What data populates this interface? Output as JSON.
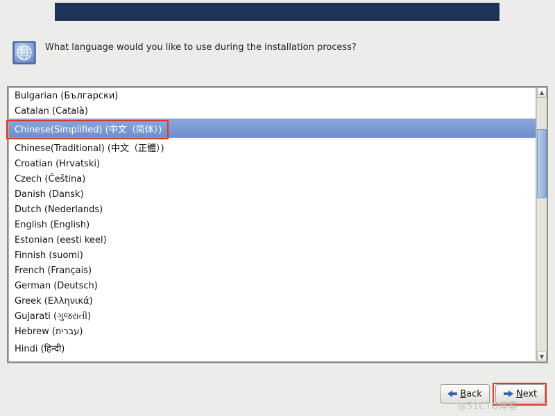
{
  "prompt": "What language would you like to use during the installation process?",
  "languages": [
    {
      "label": "Bulgarian (Български)",
      "selected": false
    },
    {
      "label": "Catalan (Català)",
      "selected": false
    },
    {
      "label": "Chinese(Simplified) (中文（简体）)",
      "selected": true
    },
    {
      "label": "Chinese(Traditional) (中文（正體）)",
      "selected": false
    },
    {
      "label": "Croatian (Hrvatski)",
      "selected": false
    },
    {
      "label": "Czech (Čeština)",
      "selected": false
    },
    {
      "label": "Danish (Dansk)",
      "selected": false
    },
    {
      "label": "Dutch (Nederlands)",
      "selected": false
    },
    {
      "label": "English (English)",
      "selected": false
    },
    {
      "label": "Estonian (eesti keel)",
      "selected": false
    },
    {
      "label": "Finnish (suomi)",
      "selected": false
    },
    {
      "label": "French (Français)",
      "selected": false
    },
    {
      "label": "German (Deutsch)",
      "selected": false
    },
    {
      "label": "Greek (Ελληνικά)",
      "selected": false
    },
    {
      "label": "Gujarati (ગુજરાતી)",
      "selected": false
    },
    {
      "label": "Hebrew (עברית)",
      "selected": false
    },
    {
      "label": "Hindi (हिन्दी)",
      "selected": false
    }
  ],
  "buttons": {
    "back": "Back",
    "next": "Next"
  },
  "watermark": "@51CTO博客"
}
